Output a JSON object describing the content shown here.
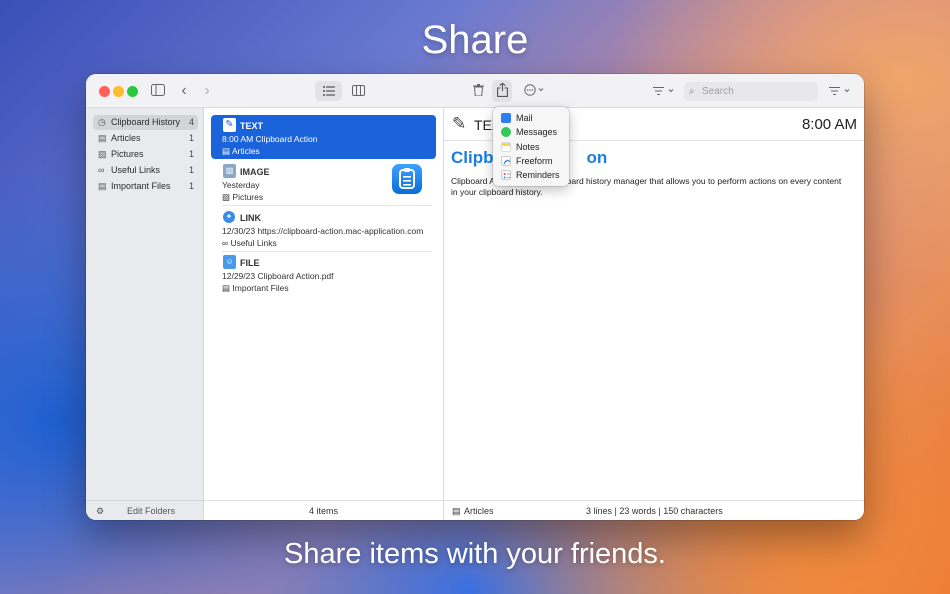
{
  "headline": "Share",
  "tagline": "Share items with your friends.",
  "toolbar": {
    "search_placeholder": "Search"
  },
  "sidebar": {
    "items": [
      {
        "label": "Clipboard History",
        "count": "4",
        "icon": "clock-icon"
      },
      {
        "label": "Articles",
        "count": "1",
        "icon": "document-icon"
      },
      {
        "label": "Pictures",
        "count": "1",
        "icon": "photo-icon"
      },
      {
        "label": "Useful Links",
        "count": "1",
        "icon": "link-icon"
      },
      {
        "label": "Important Files",
        "count": "1",
        "icon": "document-icon"
      }
    ],
    "footer": "Edit Folders"
  },
  "list": {
    "rows": [
      {
        "kind": "TEXT",
        "line2": "8:00 AM  Clipboard Action",
        "folder": "Articles"
      },
      {
        "kind": "IMAGE",
        "line2": "Yesterday",
        "folder": "Pictures"
      },
      {
        "kind": "LINK",
        "line2": "12/30/23  https://clipboard-action.mac-application.com",
        "folder": "Useful Links"
      },
      {
        "kind": "FILE",
        "line2": "12/29/23  Clipboard Action.pdf",
        "folder": "Important Files"
      }
    ],
    "footer": "4 items"
  },
  "detail": {
    "title": "TEXT",
    "time": "8:00 AM",
    "heading_left": "Clipb",
    "heading_right": "on",
    "body_left": "Clipboard A",
    "body_right": "board history manager that allows you to perform actions on every content",
    "body_line2": "in your clipboard history.",
    "footer_folder": "Articles",
    "footer_stats": "3 lines | 23 words | 150 characters"
  },
  "share_menu": {
    "items": [
      {
        "label": "Mail",
        "color": "#2f7df5"
      },
      {
        "label": "Messages",
        "color": "#34c759"
      },
      {
        "label": "Notes",
        "color": "#f7d54a"
      },
      {
        "label": "Freeform",
        "color": "#4a90e2"
      },
      {
        "label": "Reminders",
        "color": "#e5e5e5"
      }
    ]
  },
  "colors": {
    "accent": "#1a63db",
    "heading": "#1a7fe0"
  }
}
